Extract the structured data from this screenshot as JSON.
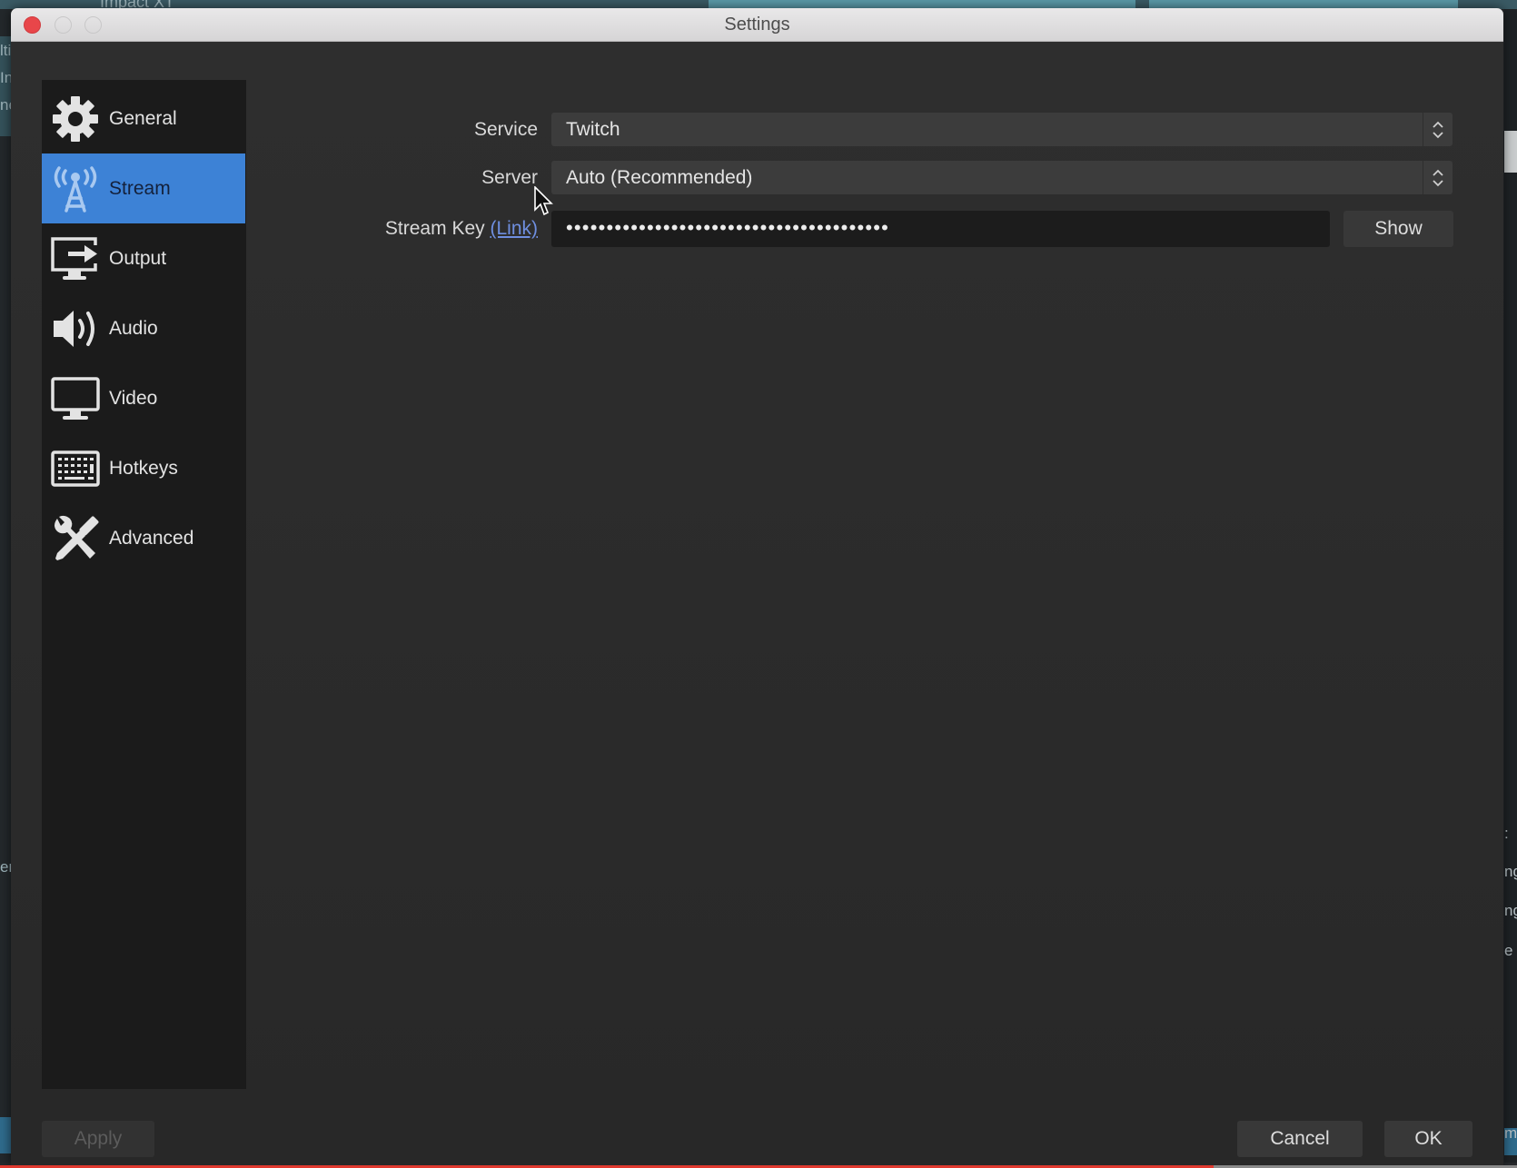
{
  "background_app": {
    "top_label": "Impact XT",
    "left_fragments": [
      "lti",
      "In",
      "ne",
      "en"
    ],
    "right_fragments": [
      ":",
      "ng",
      "ng",
      "e",
      "m"
    ]
  },
  "window": {
    "title": "Settings"
  },
  "sidebar": {
    "items": [
      {
        "label": "General",
        "icon": "gear-icon",
        "active": false
      },
      {
        "label": "Stream",
        "icon": "broadcast-tower-icon",
        "active": true
      },
      {
        "label": "Output",
        "icon": "monitor-output-icon",
        "active": false
      },
      {
        "label": "Audio",
        "icon": "speaker-icon",
        "active": false
      },
      {
        "label": "Video",
        "icon": "monitor-icon",
        "active": false
      },
      {
        "label": "Hotkeys",
        "icon": "keyboard-icon",
        "active": false
      },
      {
        "label": "Advanced",
        "icon": "wrench-screwdriver-icon",
        "active": false
      }
    ]
  },
  "stream": {
    "service_label": "Service",
    "service_value": "Twitch",
    "server_label": "Server",
    "server_value": "Auto (Recommended)",
    "stream_key_label": "Stream Key",
    "stream_key_link": "(Link)",
    "stream_key_value": "••••••••••••••••••••••••••••••••••••••••",
    "show_button": "Show"
  },
  "footer": {
    "apply": "Apply",
    "cancel": "Cancel",
    "ok": "OK"
  },
  "colors": {
    "accent": "#3d82d6",
    "link": "#6f8fe0",
    "close": "#e8464a"
  },
  "video_progress": {
    "played_fraction": 0.8
  }
}
